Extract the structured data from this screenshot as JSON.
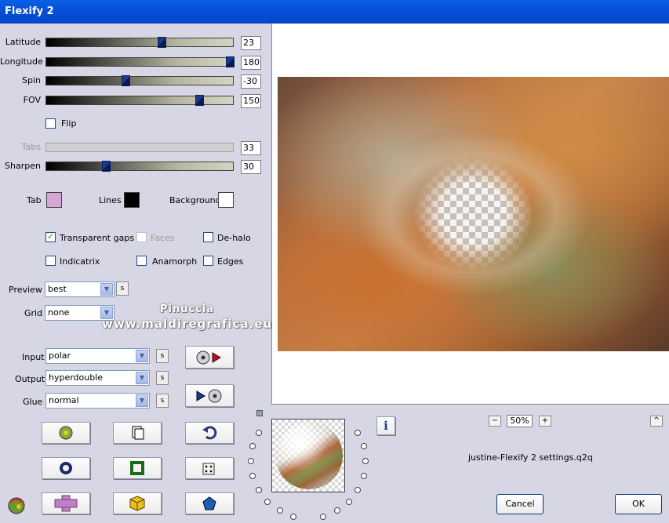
{
  "window": {
    "title": "Flexify 2"
  },
  "sliders": [
    {
      "label": "Latitude",
      "value": "23",
      "fraction": 0.62,
      "enabled": true
    },
    {
      "label": "Longitude",
      "value": "180",
      "fraction": 1.0,
      "enabled": true
    },
    {
      "label": "Spin",
      "value": "-30",
      "fraction": 0.42,
      "enabled": true
    },
    {
      "label": "FOV",
      "value": "150",
      "fraction": 0.83,
      "enabled": true
    },
    {
      "label": "Tabs",
      "value": "33",
      "fraction": 0.0,
      "enabled": false
    },
    {
      "label": "Sharpen",
      "value": "30",
      "fraction": 0.31,
      "enabled": true
    }
  ],
  "flip": {
    "label": "Flip",
    "checked": false
  },
  "colors": {
    "tab": {
      "label": "Tab",
      "color": "#d4a8d6"
    },
    "lines": {
      "label": "Lines",
      "color": "#000000"
    },
    "background": {
      "label": "Background",
      "color": "#ffffff"
    }
  },
  "options": {
    "transparent_gaps": {
      "label": "Transparent gaps",
      "checked": true
    },
    "faces": {
      "label": "Faces",
      "checked": false,
      "enabled": false
    },
    "de_halo": {
      "label": "De-halo",
      "checked": false
    },
    "indicatrix": {
      "label": "Indicatrix",
      "checked": false
    },
    "anamorph": {
      "label": "Anamorph",
      "checked": false
    },
    "edges": {
      "label": "Edges",
      "checked": false
    }
  },
  "preview": {
    "label": "Preview",
    "value": "best"
  },
  "grid": {
    "label": "Grid",
    "value": "none"
  },
  "input": {
    "label": "Input",
    "value": "polar"
  },
  "output": {
    "label": "Output",
    "value": "hyperdouble"
  },
  "glue": {
    "label": "Glue",
    "value": "normal"
  },
  "s_button_label": "s",
  "watermark": {
    "line1": "Pinuccia",
    "line2": "www.maldiregrafica.eu"
  },
  "zoom": {
    "value": "50%",
    "minus": "−",
    "plus": "+"
  },
  "scroll_up": "^",
  "info_icon": "i",
  "filename": "justine-Flexify 2 settings.q2q",
  "buttons": {
    "cancel": "Cancel",
    "ok": "OK"
  }
}
